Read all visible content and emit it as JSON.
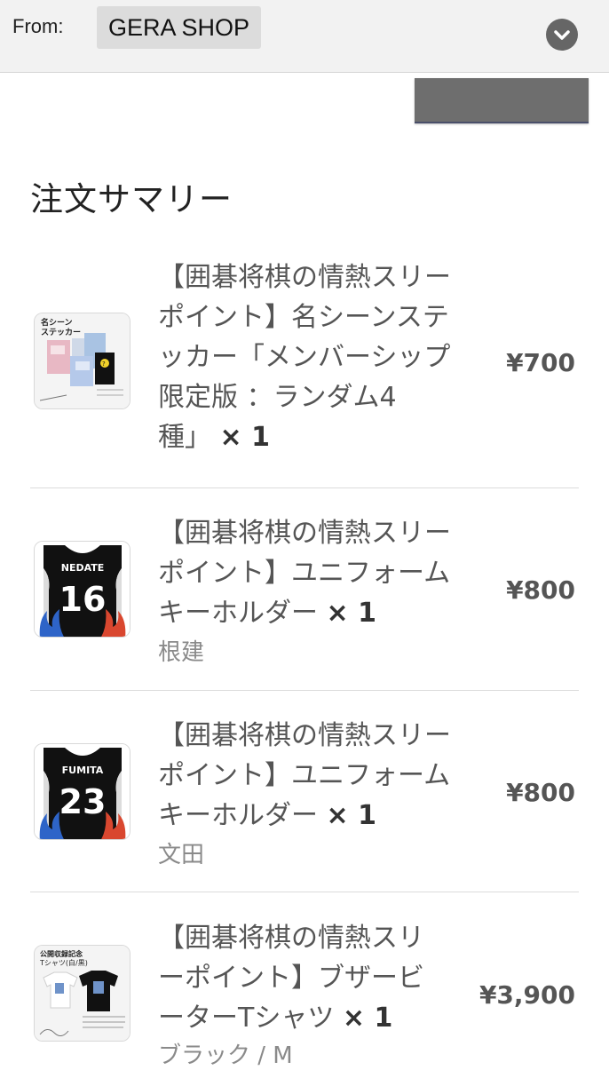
{
  "header": {
    "from_label": "From:",
    "sender": "GERA SHOP",
    "expand_icon": "chevron-down-icon"
  },
  "summary": {
    "title": "注文サマリー"
  },
  "items": [
    {
      "name": "【囲碁将棋の情熱スリーポイント】名シーンステッカー「メンバーシップ限定版 ：ランダム4種」",
      "name_lines": [
        "【囲碁将棋の情熱スリー",
        "ポイント】名シーンステ",
        "ッカー「メンバーシップ",
        "限定版 ：ランダム4",
        "種」"
      ],
      "qty": "× 1",
      "variant": "",
      "price": "¥700",
      "thumb_text": "名シーン ステッカー"
    },
    {
      "name": "【囲碁将棋の情熱スリーポイント】ユニフォームキーホルダー",
      "name_lines": [
        "【囲碁将棋の情熱スリー",
        "ポイント】ユニフォーム",
        "キーホルダー"
      ],
      "qty": "× 1",
      "variant": "根建",
      "price": "¥800",
      "jersey_name": "NEDATE",
      "jersey_number": "16"
    },
    {
      "name": "【囲碁将棋の情熱スリーポイント】ユニフォームキーホルダー",
      "name_lines": [
        "【囲碁将棋の情熱スリー",
        "ポイント】ユニフォーム",
        "キーホルダー"
      ],
      "qty": "× 1",
      "variant": "文田",
      "price": "¥800",
      "jersey_name": "FUMITA",
      "jersey_number": "23"
    },
    {
      "name": "【囲碁将棋の情熱スリーポイント】ブザービーターTシャツ",
      "name_lines": [
        "【囲碁将棋の情熱スリ",
        "ーポイント】ブザービ",
        "ーターTシャツ"
      ],
      "qty": "× 1",
      "variant": "ブラック / M",
      "price": "¥3,900",
      "thumb_text": "公開収録記念 Tシャツ(白/黒)"
    }
  ]
}
